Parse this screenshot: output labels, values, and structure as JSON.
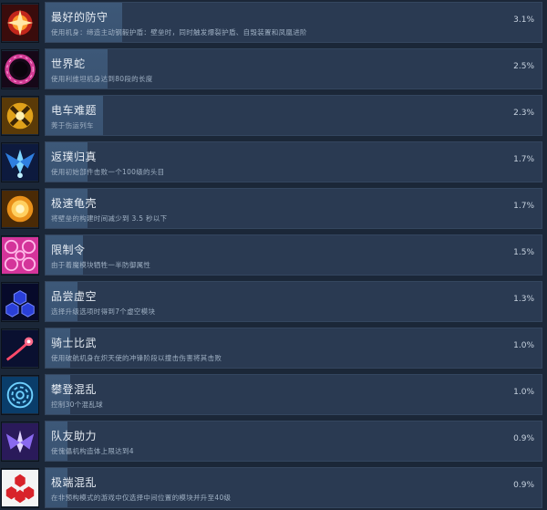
{
  "achievements": [
    {
      "title": "最好的防守",
      "description": "使用机身：缔造主动钢毅护盾：壁垒时，同时触发爆裂护盾、自毁装置和凤凰进阶",
      "percent": "3.1%",
      "rate": 3.1,
      "icon": "fire-shield-icon"
    },
    {
      "title": "世界蛇",
      "description": "使用利维坦机身达到80段的长度",
      "percent": "2.5%",
      "rate": 2.5,
      "icon": "serpent-ring-icon"
    },
    {
      "title": "电车难题",
      "description": "莠于伤运列车",
      "percent": "2.3%",
      "rate": 2.3,
      "icon": "trolley-cross-icon"
    },
    {
      "title": "返璞归真",
      "description": "使用初始部件击败一个100级的头目",
      "percent": "1.7%",
      "rate": 1.7,
      "icon": "winged-ship-icon"
    },
    {
      "title": "极速龟壳",
      "description": "将壁垒的构建时间减少到 3.5 秒以下",
      "percent": "1.7%",
      "rate": 1.7,
      "icon": "turtle-shell-icon"
    },
    {
      "title": "限制令",
      "description": "由于着魔模块牺牲一半防御属性",
      "percent": "1.5%",
      "rate": 1.5,
      "icon": "pink-spiral-icon"
    },
    {
      "title": "品尝虚空",
      "description": "选择升级选项时得到7个虚空模块",
      "percent": "1.3%",
      "rate": 1.3,
      "icon": "void-hex-icon"
    },
    {
      "title": "骑士比武",
      "description": "使用破航机身在炽天使的冲锋阶段以撞击伤害将其击败",
      "percent": "1.0%",
      "rate": 1.0,
      "icon": "comet-icon"
    },
    {
      "title": "攀登混乱",
      "description": "控制30个混乱球",
      "percent": "1.0%",
      "rate": 1.0,
      "icon": "chaos-swirl-icon"
    },
    {
      "title": "队友助力",
      "description": "使傀儡机构造体上限达到4",
      "percent": "0.9%",
      "rate": 0.9,
      "icon": "crystal-wings-icon"
    },
    {
      "title": "极端混乱",
      "description": "在非预构模式的游戏中仅选择中间位置的模块并升至40级",
      "percent": "0.9%",
      "rate": 0.9,
      "icon": "red-hex-cluster-icon"
    }
  ]
}
